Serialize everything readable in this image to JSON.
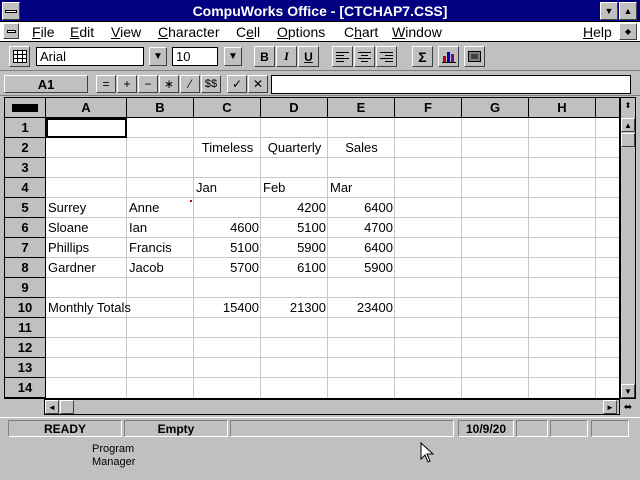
{
  "window": {
    "title": "CompuWorks Office - [CTCHAP7.CSS]"
  },
  "menu": [
    {
      "label": "File",
      "key": "F"
    },
    {
      "label": "Edit",
      "key": "E"
    },
    {
      "label": "View",
      "key": "V"
    },
    {
      "label": "Character",
      "key": "C"
    },
    {
      "label": "Cell",
      "key": "e"
    },
    {
      "label": "Options",
      "key": "O"
    },
    {
      "label": "Chart",
      "key": "h"
    },
    {
      "label": "Window",
      "key": "W"
    },
    {
      "label": "Help",
      "key": "H"
    }
  ],
  "toolbar": {
    "font": "Arial",
    "size": "10",
    "bold": "B",
    "italic": "I",
    "underline": "U",
    "sum": "Σ"
  },
  "formula": {
    "cell_ref": "A1",
    "ops": [
      "=",
      "+",
      "−",
      "∗",
      "⁄",
      "$$"
    ],
    "value": ""
  },
  "grid": {
    "columns": [
      "A",
      "B",
      "C",
      "D",
      "E",
      "F",
      "G",
      "H"
    ],
    "rows": [
      "1",
      "2",
      "3",
      "4",
      "5",
      "6",
      "7",
      "8",
      "9",
      "10",
      "11",
      "12",
      "13",
      "14"
    ],
    "cells": {
      "C2": "Timeless",
      "D2": "Quarterly",
      "E2": "Sales",
      "C4": "Jan",
      "D4": "Feb",
      "E4": "Mar",
      "A5": "Surrey",
      "B5": "Anne",
      "D5": "4200",
      "E5": "6400",
      "A6": "Sloane",
      "B6": "Ian",
      "C6": "4600",
      "D6": "5100",
      "E6": "4700",
      "A7": "Phillips",
      "B7": "Francis",
      "C7": "5100",
      "D7": "5900",
      "E7": "6400",
      "A8": "Gardner",
      "B8": "Jacob",
      "C8": "5700",
      "D8": "6100",
      "E8": "5900",
      "A10": "Monthly Totals",
      "C10": "15400",
      "D10": "21300",
      "E10": "23400"
    }
  },
  "status": {
    "mode": "READY",
    "cell_state": "Empty",
    "date": "10/9/20"
  },
  "desktop": {
    "icon_label_line1": "Program",
    "icon_label_line2": "Manager"
  }
}
